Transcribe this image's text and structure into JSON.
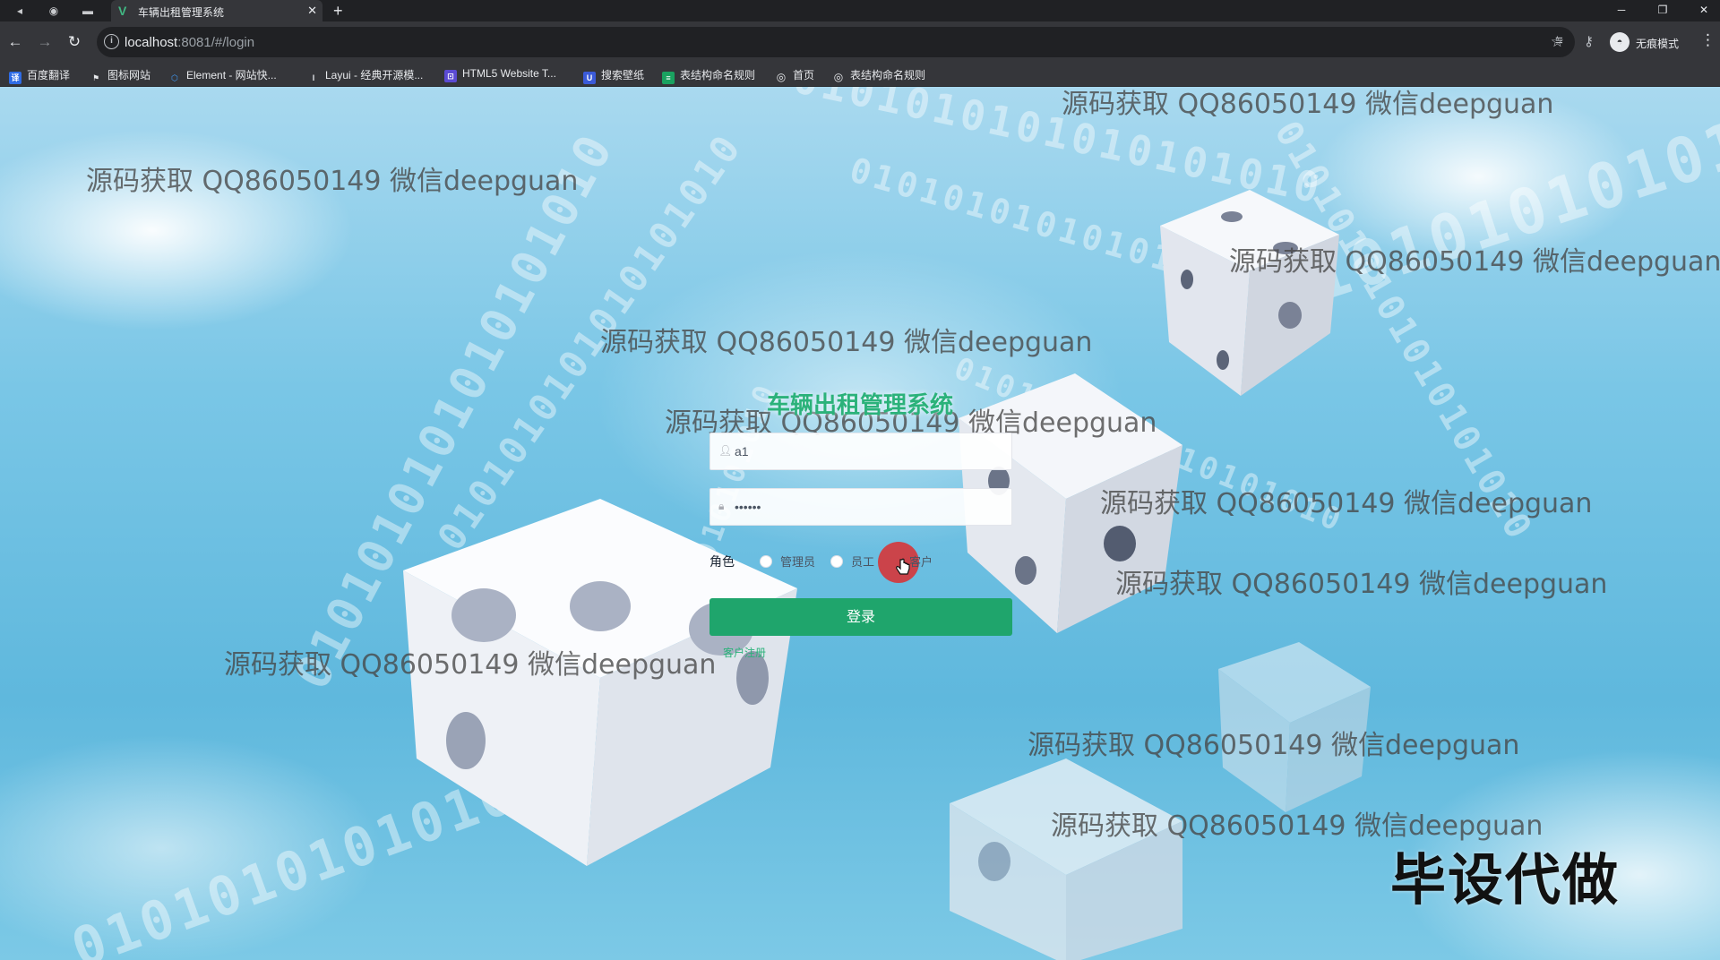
{
  "browser": {
    "tab_title": "车辆出租管理系统",
    "url_host": "localhost",
    "url_path": ":8081/#/login",
    "incognito_label": "无痕模式",
    "bookmarks": [
      {
        "label": "百度翻译",
        "icon": "baidu-translate-icon",
        "color": "#2f6ce5"
      },
      {
        "label": "图标网站",
        "icon": "flag-icon",
        "color": "#4a4a4a"
      },
      {
        "label": "Element - 网站快...",
        "icon": "element-hex-icon",
        "color": "#409eff"
      },
      {
        "label": "Layui - 经典开源模...",
        "icon": "layui-icon",
        "color": "#555555"
      },
      {
        "label": "HTML5 Website T...",
        "icon": "html5-template-icon",
        "color": "#5b4bd3"
      },
      {
        "label": "搜索壁纸",
        "icon": "wallpaper-search-icon",
        "color": "#3b5bd9"
      },
      {
        "label": "表结构命名规则",
        "icon": "sheet-icon",
        "color": "#1aa260"
      },
      {
        "label": "首页",
        "icon": "globe-icon",
        "color": "#5f6368"
      },
      {
        "label": "表结构命名规则",
        "icon": "globe-icon",
        "color": "#5f6368"
      }
    ]
  },
  "login": {
    "title": "车辆出租管理系统",
    "username_value": "a1",
    "password_value": "••••••",
    "role_label": "角色",
    "roles": [
      "管理员",
      "员工",
      "客户"
    ],
    "submit_label": "登录",
    "register_link": "客户注册",
    "accent_color": "#1fa56c"
  },
  "overlay": {
    "watermark_text": "源码获取 QQ86050149 微信deepguan",
    "corner_text": "毕设代做"
  },
  "background": {
    "binary_pattern": "0101010101010101010"
  }
}
